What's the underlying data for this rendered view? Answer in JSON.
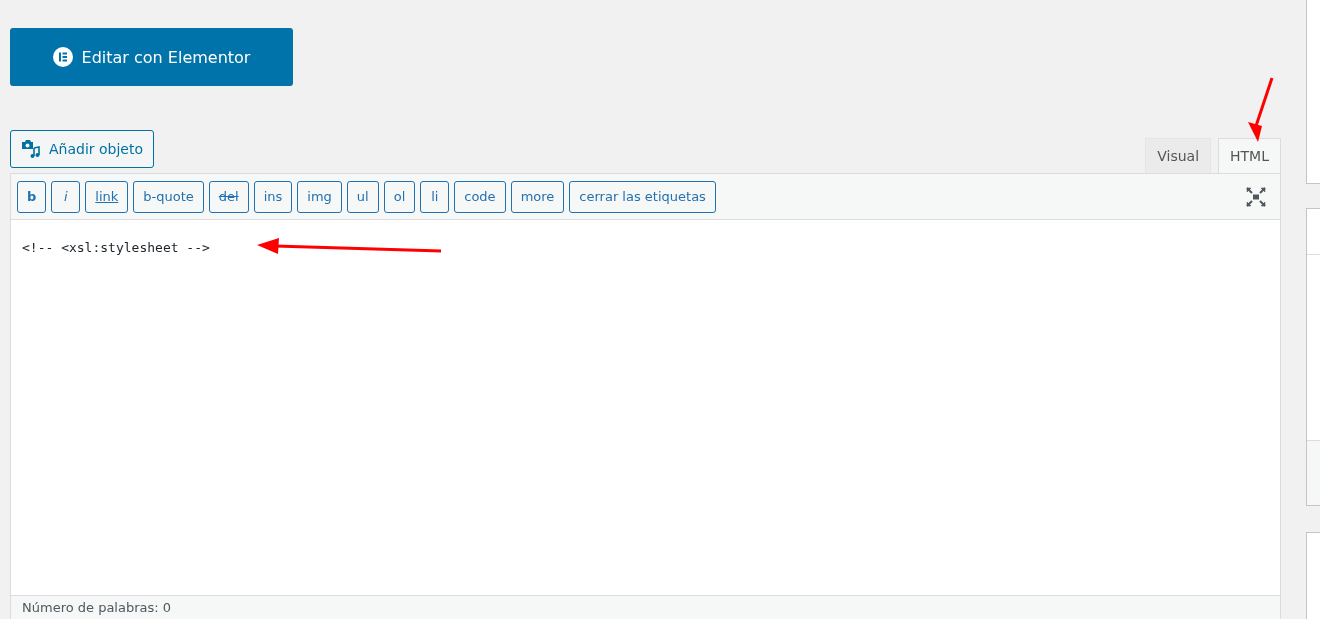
{
  "elementor_button": {
    "label": "Editar con Elementor"
  },
  "add_media_button": {
    "label": "Añadir objeto"
  },
  "editor_tabs": [
    {
      "label": "Visual",
      "selected": false
    },
    {
      "label": "HTML",
      "selected": true
    }
  ],
  "quicktags": [
    {
      "label": "b",
      "kind": "bold"
    },
    {
      "label": "i",
      "kind": "italic"
    },
    {
      "label": "link",
      "kind": "link"
    },
    {
      "label": "b-quote",
      "kind": "plain"
    },
    {
      "label": "del",
      "kind": "strike"
    },
    {
      "label": "ins",
      "kind": "plain"
    },
    {
      "label": "img",
      "kind": "plain"
    },
    {
      "label": "ul",
      "kind": "plain"
    },
    {
      "label": "ol",
      "kind": "plain"
    },
    {
      "label": "li",
      "kind": "plain"
    },
    {
      "label": "code",
      "kind": "plain"
    },
    {
      "label": "more",
      "kind": "plain"
    },
    {
      "label": "cerrar las etiquetas",
      "kind": "plain"
    }
  ],
  "editor_content": "<!-- <xsl:stylesheet -->",
  "status_bar": {
    "word_count": "Número de palabras: 0"
  }
}
